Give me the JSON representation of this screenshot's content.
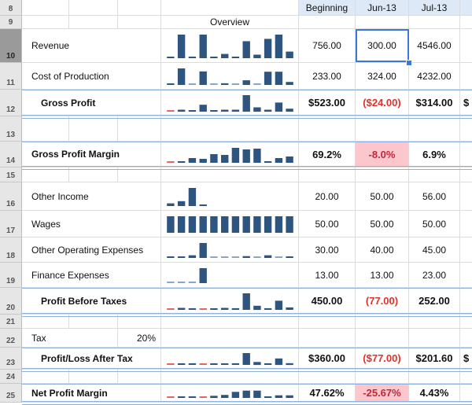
{
  "columns": {
    "overview": "Overview",
    "beginning": "Beginning",
    "jun": "Jun-13",
    "jul": "Jul-13",
    "next_partial": "$"
  },
  "row_numbers": [
    "8",
    "9",
    "10",
    "11",
    "12",
    "13",
    "14",
    "15",
    "16",
    "17",
    "18",
    "19",
    "20",
    "21",
    "22",
    "23",
    "24",
    "25"
  ],
  "selected_cell": {
    "row": "10",
    "column": "Jun-13",
    "value": "300.00"
  },
  "colors": {
    "bar": "#2d5580",
    "negative_bar": "#e06666",
    "light_bar": "#8aa6c4",
    "negative_text": "#e0302a",
    "negative_fill": "#fcc6cd",
    "accent_border": "#8fb0dc"
  },
  "rows": {
    "revenue": {
      "label": "Revenue",
      "beginning": "756.00",
      "jun": "300.00",
      "jul": "4546.00"
    },
    "cost": {
      "label": "Cost of Production",
      "beginning": "233.00",
      "jun": "324.00",
      "jul": "4232.00"
    },
    "gross_profit": {
      "label": "Gross Profit",
      "beginning": "$523.00",
      "jun": "($24.00)",
      "jul": "$314.00",
      "next": "$"
    },
    "gpm": {
      "label": "Gross Profit Margin",
      "beginning": "69.2%",
      "jun": "-8.0%",
      "jul": "6.9%"
    },
    "other_income": {
      "label": "Other Income",
      "beginning": "20.00",
      "jun": "50.00",
      "jul": "56.00"
    },
    "wages": {
      "label": "Wages",
      "beginning": "50.00",
      "jun": "50.00",
      "jul": "50.00"
    },
    "opex": {
      "label": "Other Operating Expenses",
      "beginning": "30.00",
      "jun": "40.00",
      "jul": "45.00"
    },
    "finance": {
      "label": "Finance Expenses",
      "beginning": "13.00",
      "jun": "13.00",
      "jul": "23.00"
    },
    "pbt": {
      "label": "Profit Before Taxes",
      "beginning": "450.00",
      "jun": "(77.00)",
      "jul": "252.00"
    },
    "tax": {
      "label": "Tax",
      "rate": "20%"
    },
    "plat": {
      "label": "Profit/Loss After Tax",
      "beginning": "$360.00",
      "jun": "($77.00)",
      "jul": "$201.60",
      "next": "$"
    },
    "npm": {
      "label": "Net Profit Margin",
      "beginning": "47.62%",
      "jun": "-25.67%",
      "jul": "4.43%"
    }
  },
  "chart_data": [
    {
      "type": "bar",
      "title": "Revenue sparkline",
      "values": [
        0.05,
        1.0,
        0.05,
        1.0,
        0.05,
        0.18,
        0.05,
        0.72,
        0.15,
        0.82,
        1.0,
        0.28
      ]
    },
    {
      "type": "bar",
      "title": "Cost of Production sparkline",
      "values": [
        0.06,
        1.0,
        0.02,
        0.82,
        0.02,
        0.1,
        0.02,
        0.28,
        0.02,
        0.8,
        0.8,
        0.18
      ]
    },
    {
      "type": "bar",
      "title": "Gross Profit sparkline",
      "values": [
        -0.03,
        0.12,
        0.05,
        0.42,
        0.05,
        0.12,
        0.12,
        1.0,
        0.26,
        0.12,
        0.55,
        0.18
      ]
    },
    {
      "type": "bar",
      "title": "Gross Profit Margin sparkline",
      "values": [
        -0.1,
        0.1,
        0.3,
        0.25,
        0.55,
        0.5,
        0.95,
        0.85,
        0.9,
        0.1,
        0.3,
        0.4
      ]
    },
    {
      "type": "bar",
      "title": "Other Income sparkline",
      "values": [
        0.15,
        0.27,
        1.0,
        0.06,
        0,
        0,
        0,
        0,
        0,
        0,
        0,
        0
      ]
    },
    {
      "type": "bar",
      "title": "Wages sparkline",
      "values": [
        1,
        1,
        1,
        1,
        1,
        1,
        1,
        1,
        1,
        1,
        1,
        1
      ]
    },
    {
      "type": "bar",
      "title": "Other Operating Expenses sparkline",
      "values": [
        0.08,
        0.08,
        0.18,
        1.0,
        0.04,
        0.04,
        0.04,
        0.12,
        0.04,
        0.18,
        0.04,
        0.08
      ]
    },
    {
      "type": "bar",
      "title": "Finance Expenses sparkline",
      "values": [
        0.04,
        0.04,
        0.04,
        1.0,
        0,
        0,
        0,
        0,
        0,
        0,
        0,
        0
      ]
    },
    {
      "type": "bar",
      "title": "Profit Before Taxes sparkline",
      "values": [
        -0.05,
        0.12,
        0.06,
        -0.05,
        0.06,
        0.12,
        0.1,
        1.0,
        0.25,
        0.1,
        0.55,
        0.15
      ]
    },
    {
      "type": "bar",
      "title": "Profit/Loss After Tax sparkline",
      "values": [
        -0.05,
        0.12,
        0.06,
        -0.05,
        0.06,
        0.12,
        0.1,
        1.0,
        0.25,
        0.06,
        0.55,
        0.15
      ]
    },
    {
      "type": "bar",
      "title": "Net Profit Margin sparkline",
      "values": [
        -0.35,
        0.05,
        0.05,
        -0.05,
        0.25,
        0.35,
        0.7,
        0.85,
        0.85,
        0.05,
        0.3,
        0.3
      ]
    }
  ]
}
